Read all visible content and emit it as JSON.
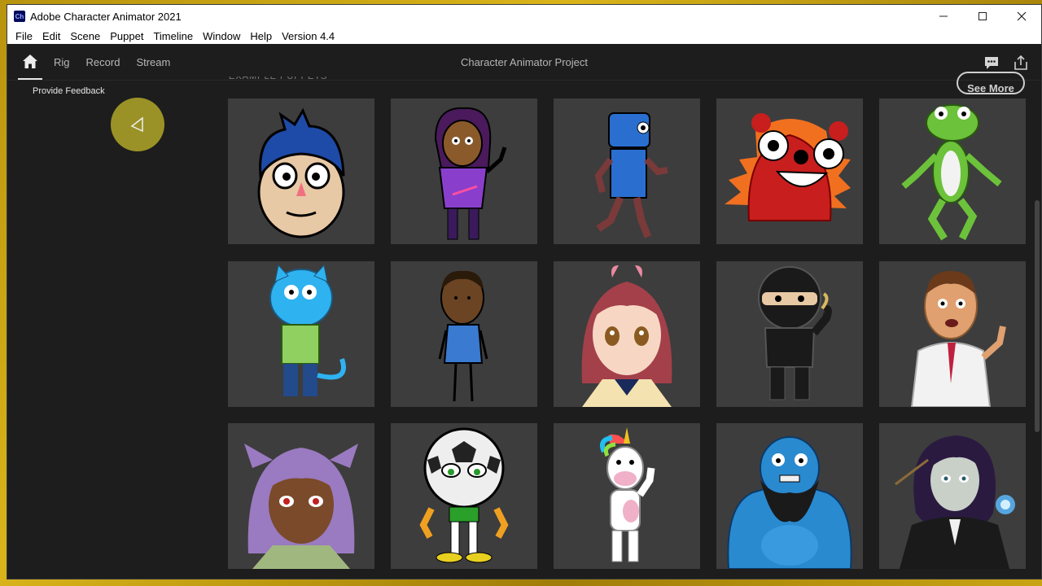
{
  "window": {
    "title": "Adobe Character Animator 2021",
    "app_icon": "Ch"
  },
  "menu": [
    "File",
    "Edit",
    "Scene",
    "Puppet",
    "Timeline",
    "Window",
    "Help",
    "Version 4.4"
  ],
  "workspace_tabs": [
    "Rig",
    "Record",
    "Stream"
  ],
  "project_title": "Character Animator Project",
  "sidebar": {
    "feedback_label": "Provide Feedback"
  },
  "section": {
    "label": "EXAMPLE PUPPETS",
    "see_more_label": "See More"
  },
  "puppets": [
    {
      "name": "blue-hair-boy"
    },
    {
      "name": "purple-girl"
    },
    {
      "name": "blue-robot"
    },
    {
      "name": "red-monster"
    },
    {
      "name": "green-frog"
    },
    {
      "name": "blue-cat"
    },
    {
      "name": "stick-boy"
    },
    {
      "name": "anime-girl"
    },
    {
      "name": "ninja"
    },
    {
      "name": "doctor"
    },
    {
      "name": "cat-girl"
    },
    {
      "name": "soccer-ball"
    },
    {
      "name": "unicorn"
    },
    {
      "name": "blue-ogre"
    },
    {
      "name": "witch"
    }
  ],
  "colors": {
    "card_bg": "#3d3d3d",
    "app_bg": "#1d1d1d",
    "accent_cursor": "#a8a028"
  }
}
